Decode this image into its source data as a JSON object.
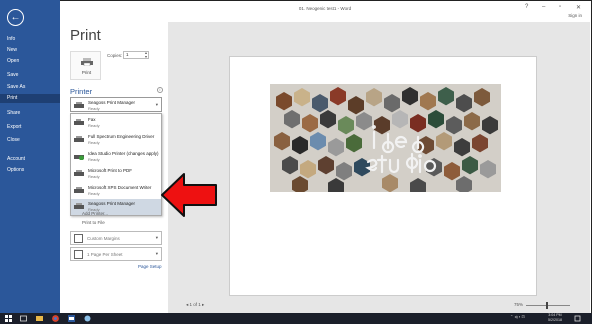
{
  "window": {
    "title": "01. Neogenic test1 - Word",
    "sign_in": "Sign in",
    "controls": [
      "?",
      "–",
      "▫",
      "✕"
    ]
  },
  "nav": {
    "back": "←",
    "items": [
      {
        "label": "Info"
      },
      {
        "label": "New"
      },
      {
        "label": "Open"
      },
      {
        "label": "Save"
      },
      {
        "label": "Save As"
      },
      {
        "label": "Print",
        "active": true
      },
      {
        "label": "Share"
      },
      {
        "label": "Export"
      },
      {
        "label": "Close"
      },
      {
        "label": "Account"
      },
      {
        "label": "Options"
      }
    ]
  },
  "print": {
    "title": "Print",
    "button_label": "Print",
    "copies_label": "Copies:",
    "copies_value": "1",
    "printer_heading": "Printer",
    "info": "i",
    "selected_printer": {
      "name": "Seagoss Print Manager",
      "status": "Ready"
    },
    "printers": [
      {
        "name": "Fax",
        "status": "Ready"
      },
      {
        "name": "Full Spectrum Engineering Driver",
        "status": "Ready"
      },
      {
        "name": "Idea Studio Printer (changes apply)",
        "status": "Ready"
      },
      {
        "name": "Microsoft Print to PDF",
        "status": "Ready"
      },
      {
        "name": "Microsoft XPS Document Writer",
        "status": "Ready"
      },
      {
        "name": "Seagoss Print Manager",
        "status": "Ready",
        "highlighted": true
      }
    ],
    "add_printer": "Add Printer...",
    "print_to_file": "Print to File",
    "settings": [
      {
        "label": "Custom Margins"
      },
      {
        "label": "1 Page Per Sheet"
      }
    ],
    "page_setup": "Page Setup"
  },
  "preview": {
    "page_nav": "◂ 1 of 1 ▸",
    "zoom": "75%"
  },
  "taskbar": {
    "tray": "⌃ ◂) ▪ ⊡",
    "time": "3:04 PM",
    "date": "5/2/2018"
  },
  "colors": {
    "accent": "#2b579a",
    "arrow": "#ee1111"
  }
}
